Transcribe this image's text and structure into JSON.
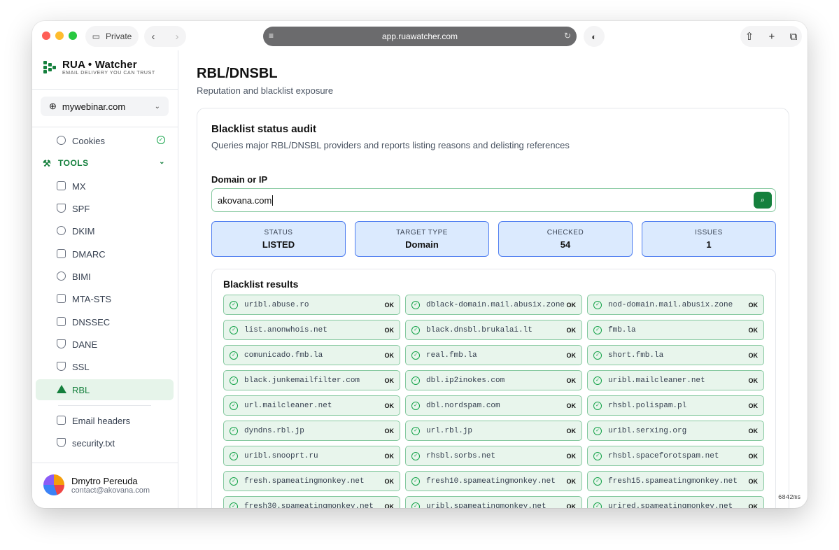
{
  "browser": {
    "private_label": "Private",
    "url": "app.ruawatcher.com"
  },
  "brand": {
    "name": "RUA • Watcher",
    "tagline": "EMAIL DELIVERY YOU CAN TRUST"
  },
  "domain_selector": {
    "value": "mywebinar.com"
  },
  "sidebar": {
    "cookies": "Cookies",
    "tools_label": "TOOLS",
    "items": [
      {
        "label": "MX",
        "icon": "server-icon"
      },
      {
        "label": "SPF",
        "icon": "shield-icon"
      },
      {
        "label": "DKIM",
        "icon": "key-icon"
      },
      {
        "label": "DMARC",
        "icon": "mail-icon"
      },
      {
        "label": "BIMI",
        "icon": "fingerprint-icon"
      },
      {
        "label": "MTA-STS",
        "icon": "lock-icon"
      },
      {
        "label": "DNSSEC",
        "icon": "lock-icon"
      },
      {
        "label": "DANE",
        "icon": "shield-icon"
      },
      {
        "label": "SSL",
        "icon": "shield-check-icon"
      },
      {
        "label": "RBL",
        "icon": "warning-icon"
      }
    ],
    "extra": [
      {
        "label": "Email headers",
        "icon": "document-icon"
      },
      {
        "label": "security.txt",
        "icon": "shield-icon"
      }
    ]
  },
  "user": {
    "name": "Dmytro Pereuda",
    "email": "contact@akovana.com"
  },
  "page": {
    "title": "RBL/DNSBL",
    "subtitle": "Reputation and blacklist exposure"
  },
  "audit": {
    "title": "Blacklist status audit",
    "description": "Queries major RBL/DNSBL providers and reports listing reasons and delisting references",
    "field_label": "Domain or IP",
    "field_value": "akovana.com"
  },
  "stats": [
    {
      "label": "STATUS",
      "value": "LISTED"
    },
    {
      "label": "TARGET TYPE",
      "value": "Domain"
    },
    {
      "label": "CHECKED",
      "value": "54"
    },
    {
      "label": "ISSUES",
      "value": "1"
    }
  ],
  "results": {
    "title": "Blacklist results",
    "ok_label": "OK",
    "items": [
      "uribl.abuse.ro",
      "dblack-domain.mail.abusix.zone",
      "nod-domain.mail.abusix.zone",
      "list.anonwhois.net",
      "black.dnsbl.brukalai.lt",
      "fmb.la",
      "comunicado.fmb.la",
      "real.fmb.la",
      "short.fmb.la",
      "black.junkemailfilter.com",
      "dbl.ip2inokes.com",
      "uribl.mailcleaner.net",
      "url.mailcleaner.net",
      "dbl.nordspam.com",
      "rhsbl.polispam.pl",
      "dyndns.rbl.jp",
      "url.rbl.jp",
      "uribl.serxing.org",
      "uribl.snooprt.ru",
      "rhsbl.sorbs.net",
      "rhsbl.spaceforotspam.net",
      "fresh.spameatingmonkey.net",
      "fresh10.spameatingmonkey.net",
      "fresh15.spameatingmonkey.net",
      "fresh30.spameatingmonkey.net",
      "uribl.spameatingmonkey.net",
      "urired.spameatingmonkey.net"
    ]
  },
  "timing": "6842ms",
  "colors": {
    "accent": "#15803d",
    "stat_bg": "#dbeafe",
    "ok_bg": "#e8f5ec"
  }
}
